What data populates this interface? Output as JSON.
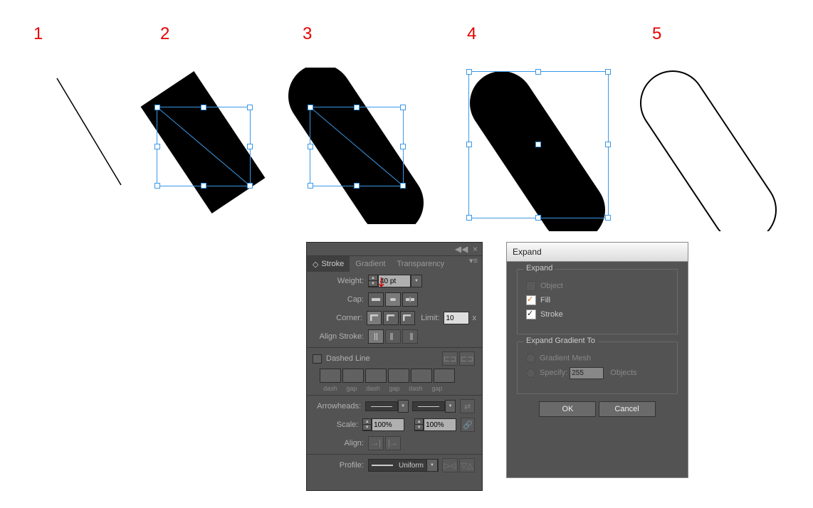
{
  "steps": {
    "n1": "1",
    "n2": "2",
    "n3": "3",
    "n4": "4",
    "n5": "5"
  },
  "stroke_panel": {
    "tabs": {
      "stroke": "Stroke",
      "gradient": "Gradient",
      "transparency": "Transparency"
    },
    "weight_label": "Weight:",
    "weight_value": "40 pt",
    "cap_label": "Cap:",
    "corner_label": "Corner:",
    "limit_label": "Limit:",
    "limit_value": "10",
    "limit_unit": "x",
    "align_stroke_label": "Align Stroke:",
    "dashed_label": "Dashed Line",
    "dash": "dash",
    "gap": "gap",
    "arrowheads_label": "Arrowheads:",
    "scale_label": "Scale:",
    "scale_value": "100%",
    "align_label": "Align:",
    "profile_label": "Profile:",
    "profile_value": "Uniform"
  },
  "expand_dialog": {
    "title": "Expand",
    "section1": "Expand",
    "object": "Object",
    "fill": "Fill",
    "stroke": "Stroke",
    "section2": "Expand Gradient To",
    "grad_mesh": "Gradient Mesh",
    "specify": "Specify:",
    "specify_value": "255",
    "objects_label": "Objects",
    "ok": "OK",
    "cancel": "Cancel"
  },
  "chart_data": null
}
